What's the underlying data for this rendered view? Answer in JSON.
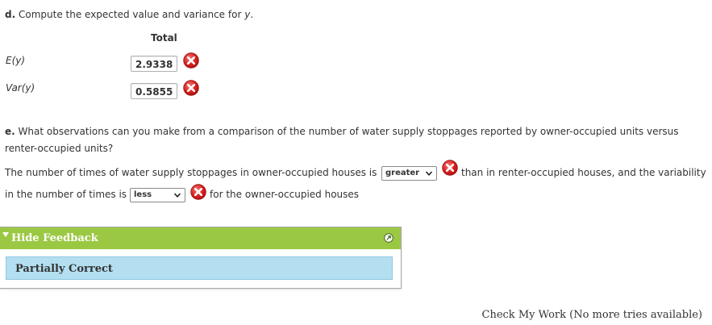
{
  "part_d": {
    "letter": "d.",
    "prompt": "Compute the expected value and variance for",
    "variable": "y",
    "column_header": "Total",
    "rows": [
      {
        "label": "E(y)",
        "value": "2.9338",
        "status": "incorrect"
      },
      {
        "label": "Var(y)",
        "value": "0.5855",
        "status": "incorrect"
      }
    ]
  },
  "part_e": {
    "letter": "e.",
    "question_line1": "What observations can you make from a comparison of the number of water supply stoppages reported by owner-occupied units versus",
    "question_line2": "renter-occupied units?",
    "sentence_a": "The number of times of water supply stoppages in owner-occupied houses is",
    "select1_value": "greater",
    "sentence_b": "than in renter-occupied houses, and the variability",
    "sentence_c": "in the number of times is",
    "select2_value": "less",
    "sentence_d": "for the owner-occupied houses"
  },
  "feedback": {
    "toggle_label": "Hide Feedback",
    "status": "Partially Correct",
    "header_color": "#9bc843",
    "body_color": "#b3dff1"
  },
  "footer": {
    "check_label": "Check My Work (No more tries available)"
  },
  "icons": {
    "incorrect": "x-circle-icon",
    "dropdown": "chevron-down-icon",
    "collapse": "triangle-down-icon",
    "expand": "circle-arrow-icon"
  }
}
